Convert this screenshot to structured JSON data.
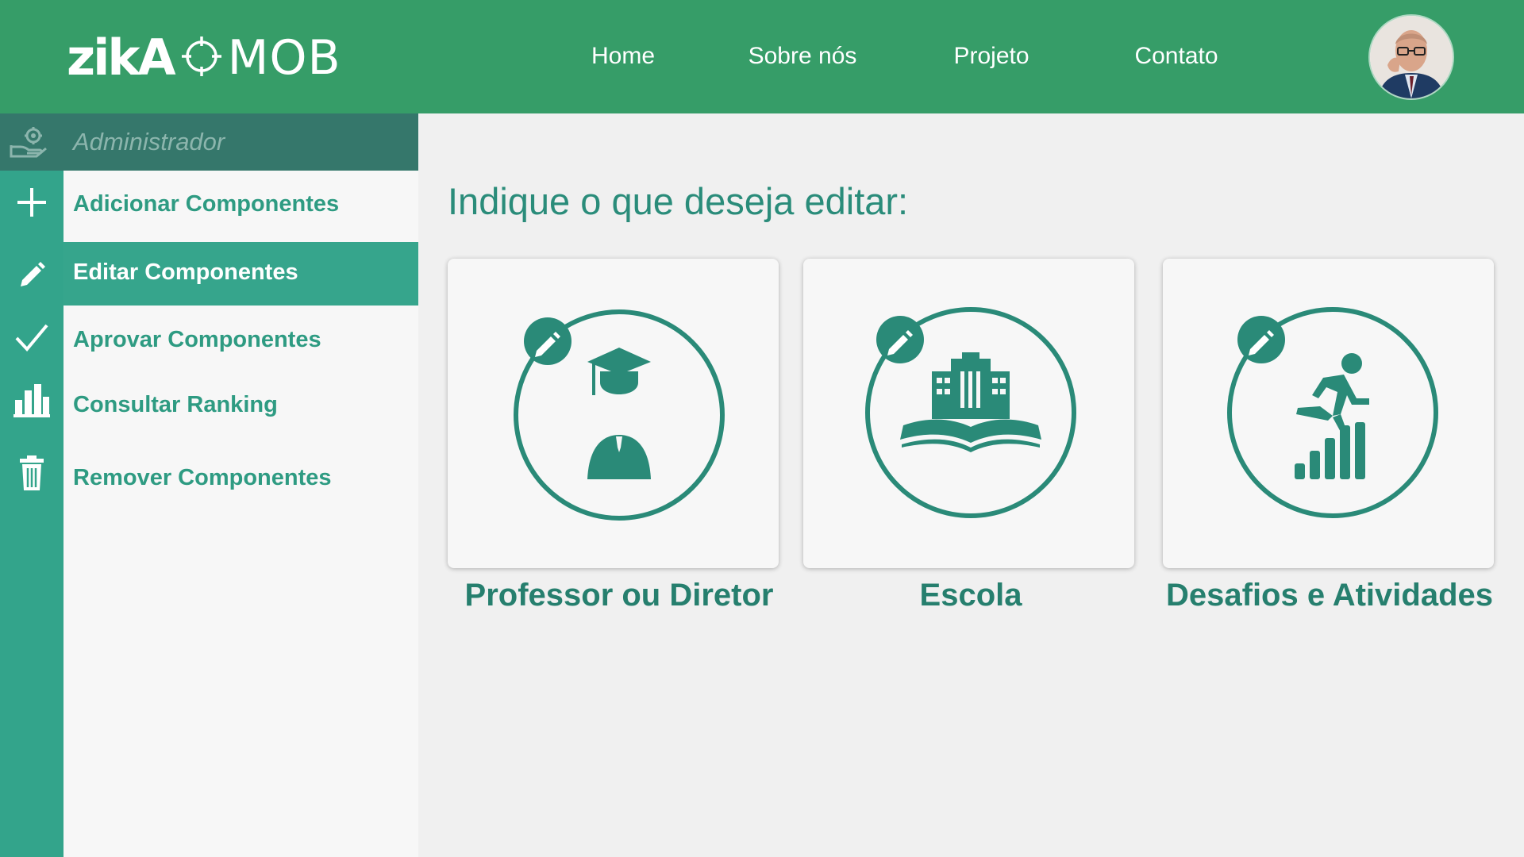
{
  "brand": {
    "word1": "zikA",
    "word2": "MOB"
  },
  "nav": {
    "items": [
      "Home",
      "Sobre nós",
      "Projeto",
      "Contato"
    ]
  },
  "user": {
    "avatar_icon": "user-avatar-photo"
  },
  "sidebar": {
    "header": {
      "label": "Administrador",
      "icon": "hand-gear-icon"
    },
    "items": [
      {
        "label": "Adicionar Componentes",
        "icon": "plus-icon",
        "active": false
      },
      {
        "label": "Editar Componentes",
        "icon": "pencil-icon",
        "active": true
      },
      {
        "label": "Aprovar Componentes",
        "icon": "check-icon",
        "active": false
      },
      {
        "label": "Consultar Ranking",
        "icon": "bar-chart-icon",
        "active": false
      },
      {
        "label": "Remover Componentes",
        "icon": "trash-icon",
        "active": false
      }
    ]
  },
  "main": {
    "prompt": "Indique o que deseja editar:",
    "cards": [
      {
        "label": "Professor ou Diretor",
        "icon": "graduate-icon"
      },
      {
        "label": "Escola",
        "icon": "school-book-icon"
      },
      {
        "label": "Desafios e Atividades",
        "icon": "runner-steps-icon"
      }
    ]
  },
  "colors": {
    "header": "#369d68",
    "rail": "#33a48b",
    "admin_bar": "#35776b",
    "accent": "#2a8c7a",
    "panel": "#f7f7f7",
    "background": "#f0f0f0"
  }
}
